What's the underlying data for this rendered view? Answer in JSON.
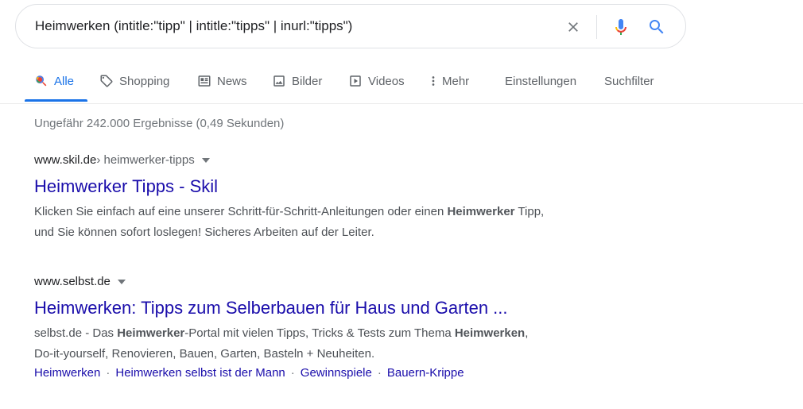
{
  "search": {
    "query": "Heimwerken (intitle:\"tipp\" | intitle:\"tipps\" | inurl:\"tipps\")",
    "icons": {
      "clear": "close-icon",
      "mic": "microphone-icon",
      "search": "search-icon"
    },
    "mic_colors": [
      "#4285f4",
      "#ea4335",
      "#fbbc05",
      "#34a853"
    ]
  },
  "tabs": [
    {
      "label": "Alle",
      "icon": "search-icon",
      "active": true
    },
    {
      "label": "Shopping",
      "icon": "tag-icon"
    },
    {
      "label": "News",
      "icon": "news-icon"
    },
    {
      "label": "Bilder",
      "icon": "image-icon"
    },
    {
      "label": "Videos",
      "icon": "play-icon"
    },
    {
      "label": "Mehr",
      "icon": "more-vert-icon"
    },
    {
      "label": "Einstellungen"
    },
    {
      "label": "Suchfilter"
    }
  ],
  "stats": "Ungefähr 242.000 Ergebnisse (0,49 Sekunden)",
  "results": [
    {
      "domain": "www.skil.de",
      "path": " › heimwerker-tipps",
      "title": "Heimwerker Tipps - Skil",
      "snippet_line1": [
        {
          "text": "Klicken Sie einfach auf eine unserer Schritt-für-Schritt-Anleitungen oder einen ",
          "bold": false
        },
        {
          "text": "Heimwerker",
          "bold": true
        },
        {
          "text": " Tipp,",
          "bold": false
        }
      ],
      "snippet_line2": "und Sie können sofort loslegen! Sicheres Arbeiten auf der Leiter."
    },
    {
      "domain": "www.selbst.de",
      "path": "",
      "title": "Heimwerken: Tipps zum Selberbauen für Haus und Garten ...",
      "snippet_line1": [
        {
          "text": "selbst.de - Das ",
          "bold": false
        },
        {
          "text": "Heimwerker",
          "bold": true
        },
        {
          "text": "-Portal mit vielen Tipps, Tricks & Tests zum Thema ",
          "bold": false
        },
        {
          "text": "Heimwerken",
          "bold": true
        },
        {
          "text": ",",
          "bold": false
        }
      ],
      "snippet_line2": "Do-it-yourself, Renovieren, Bauen, Garten, Basteln + Neuheiten.",
      "sitelinks": [
        "Heimwerken",
        "Heimwerken selbst ist der Mann",
        "Gewinnspiele",
        "Bauern-Krippe"
      ],
      "sitelink_separator": "·"
    }
  ],
  "colors": {
    "link": "#1a0dab",
    "accent": "#1a73e8",
    "text_secondary": "#70757a"
  }
}
